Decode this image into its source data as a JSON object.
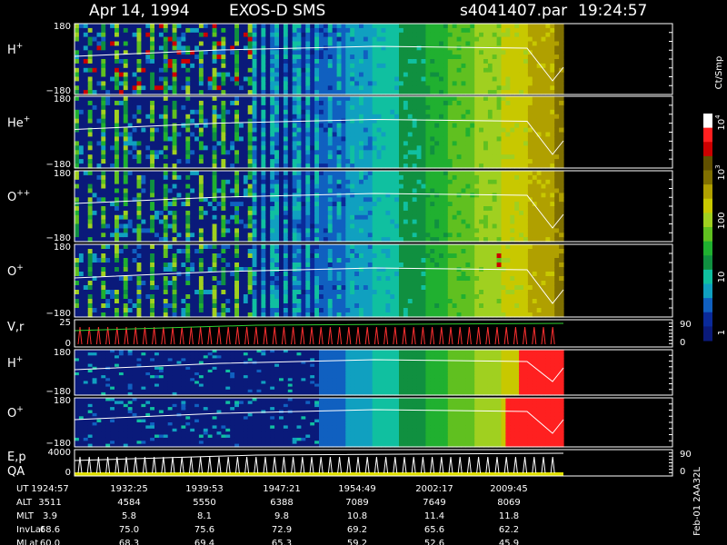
{
  "header": {
    "date": "Apr 14, 1994",
    "instrument": "EXOS-D SMS",
    "file": "s4041407.par",
    "time": "19:24:57"
  },
  "chart_data": {
    "type": "heatmap",
    "x_ticks": [
      "1924:57",
      "1932:25",
      "1939:53",
      "1947:21",
      "1954:49",
      "2002:17",
      "2009:45"
    ],
    "panels": [
      {
        "label": "H",
        "sup": "+",
        "ymax": "180",
        "ymin": "−180"
      },
      {
        "label": "He",
        "sup": "+",
        "ymax": "180",
        "ymin": "−180"
      },
      {
        "label": "O",
        "sup": "++",
        "ymax": "180",
        "ymin": "−180"
      },
      {
        "label": "O",
        "sup": "+",
        "ymax": "180",
        "ymin": "−180"
      },
      {
        "label": "V,r",
        "sup": "",
        "ymax": "25",
        "ymin": "0",
        "right_top": "90",
        "right_bottom": "0"
      },
      {
        "label": "H",
        "sup": "+",
        "ymax": "180",
        "ymin": "−180"
      },
      {
        "label": "O",
        "sup": "+",
        "ymax": "180",
        "ymin": "−180"
      },
      {
        "label": "E,p",
        "label2": "QA",
        "ymax": "4000",
        "ymin": "0",
        "right_top": "90",
        "right_bottom": "0"
      }
    ],
    "colorbar": {
      "unit": "Ct/Smp",
      "ticks": [
        {
          "text": "10",
          "sup": "4",
          "value": 10000
        },
        {
          "text": "10",
          "sup": "3",
          "value": 1000
        },
        {
          "text": "100",
          "sup": "",
          "value": 100
        },
        {
          "text": "10",
          "sup": "",
          "value": 10
        },
        {
          "text": "1",
          "sup": "",
          "value": 1
        }
      ],
      "colors": [
        "#0a1a7a",
        "#0a2a9a",
        "#1060c0",
        "#10a0c0",
        "#10c0a0",
        "#109040",
        "#20b030",
        "#60c020",
        "#a0d020",
        "#c8c800",
        "#b0a000",
        "#807000",
        "#605000",
        "#cc0000",
        "#ff2020",
        "#ffffff"
      ]
    },
    "orbit_table": {
      "rows": [
        {
          "name": "UT",
          "values": [
            "1924:57",
            "1932:25",
            "1939:53",
            "1947:21",
            "1954:49",
            "2002:17",
            "2009:45"
          ]
        },
        {
          "name": "ALT",
          "values": [
            "3511",
            "4584",
            "5550",
            "6388",
            "7089",
            "7649",
            "8069"
          ]
        },
        {
          "name": "MLT",
          "values": [
            "3.9",
            "5.8",
            "8.1",
            "9.8",
            "10.8",
            "11.4",
            "11.8"
          ]
        },
        {
          "name": "InvLat",
          "values": [
            "68.6",
            "75.0",
            "75.6",
            "72.9",
            "69.2",
            "65.6",
            "62.2"
          ]
        },
        {
          "name": "MLat",
          "values": [
            "60.0",
            "68.3",
            "69.4",
            "65.3",
            "59.2",
            "52.6",
            "45.9"
          ]
        }
      ]
    },
    "footer_code": "Feb-01 2AA32L"
  }
}
